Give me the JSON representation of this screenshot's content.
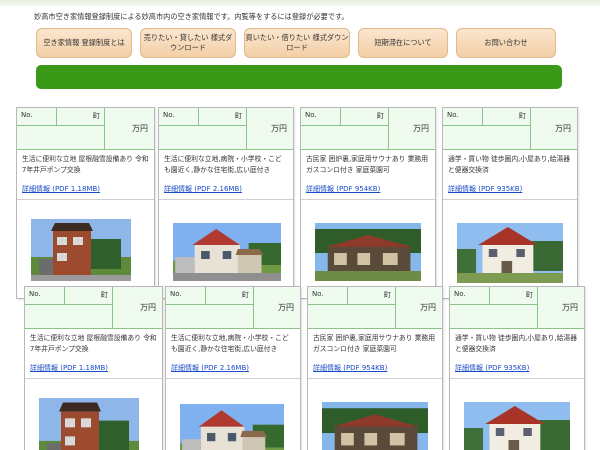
{
  "intro_text": "妙高市空き家情報登録制度による妙高市内の空き家情報です。内覧等をするには登録が必要です。",
  "nav": [
    {
      "label": "空き家情報 登録制度とは"
    },
    {
      "label": "売りたい・貸したい 様式ダウンロード"
    },
    {
      "label": "買いたい・借りたい 様式ダウンロード"
    },
    {
      "label": "短期滞在について"
    },
    {
      "label": "お問い合わせ"
    }
  ],
  "labels": {
    "no": "No.",
    "town": "町",
    "price": "万円"
  },
  "listings": [
    {
      "desc": "生活に便利な立地 屋根融雪設備あり 令和7年井戸ポンプ交換",
      "link": "詳細情報 (PDF 1.18MB)"
    },
    {
      "desc": "生活に便利な立地,病院・小学校・こども園近く,静かな住宅街,広い庭付き",
      "link": "詳細情報 (PDF 2.16MB)"
    },
    {
      "desc": "古民家 囲炉裏,家庭用サウナあり 業務用ガスコンロ付き 家庭菜園可",
      "link": "詳細情報 (PDF 954KB)"
    },
    {
      "desc": "通学・買い物 徒歩圏内,小屋あり,給湯器と便器交換済",
      "link": "詳細情報 (PDF 935KB)"
    }
  ],
  "colors": {
    "accent_green": "#3a9a17",
    "nav_orange": "#f3cfa6",
    "link_blue": "#1a4cc8",
    "head_bg": "#f0fbef"
  }
}
